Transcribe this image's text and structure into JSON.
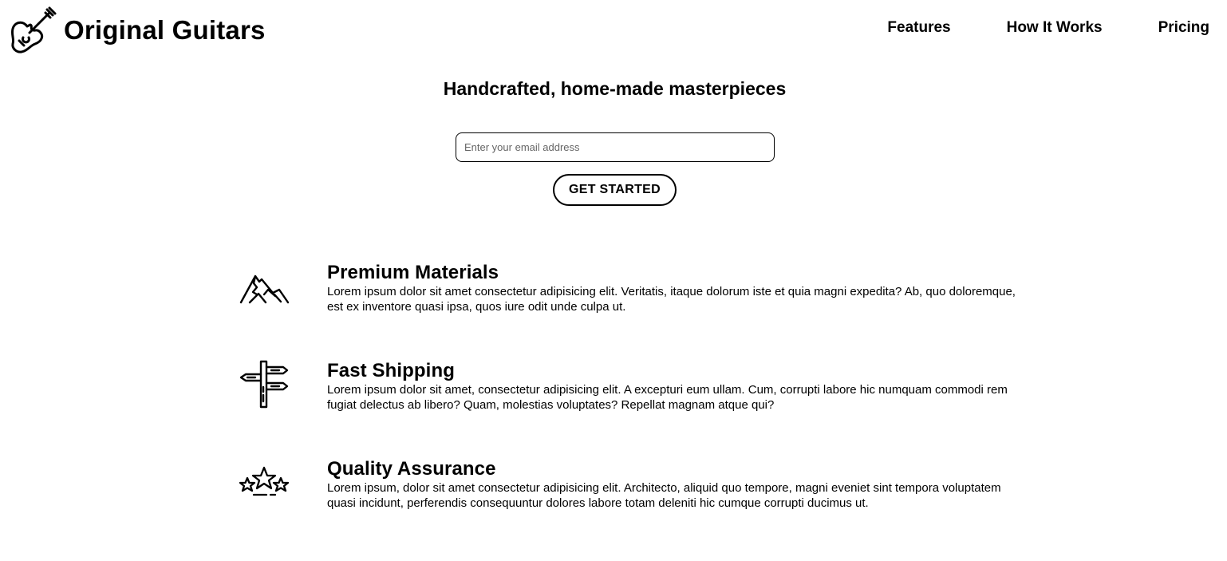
{
  "header": {
    "brand_name": "Original Guitars",
    "brand_icon": "guitar-icon",
    "nav": [
      {
        "label": "Features"
      },
      {
        "label": "How It Works"
      },
      {
        "label": "Pricing"
      }
    ]
  },
  "hero": {
    "title": "Handcrafted, home-made masterpieces",
    "email_placeholder": "Enter your email address",
    "email_value": "",
    "cta_label": "GET STARTED"
  },
  "features": [
    {
      "icon": "mountain-icon",
      "title": "Premium Materials",
      "description": "Lorem ipsum dolor sit amet consectetur adipisicing elit. Veritatis, itaque dolorum iste et quia magni expedita? Ab, quo doloremque, est ex inventore quasi ipsa, quos iure odit unde culpa ut."
    },
    {
      "icon": "signpost-icon",
      "title": "Fast Shipping",
      "description": "Lorem ipsum dolor sit amet, consectetur adipisicing elit. A excepturi eum ullam. Cum, corrupti labore hic numquam commodi rem fugiat delectus ab libero? Quam, molestias voluptates? Repellat magnam atque qui?"
    },
    {
      "icon": "stars-icon",
      "title": "Quality Assurance",
      "description": "Lorem ipsum, dolor sit amet consectetur adipisicing elit. Architecto, aliquid quo tempore, magni eveniet sint tempora voluptatem quasi incidunt, perferendis consequuntur dolores labore totam deleniti hic cumque corrupti ducimus ut."
    }
  ]
}
